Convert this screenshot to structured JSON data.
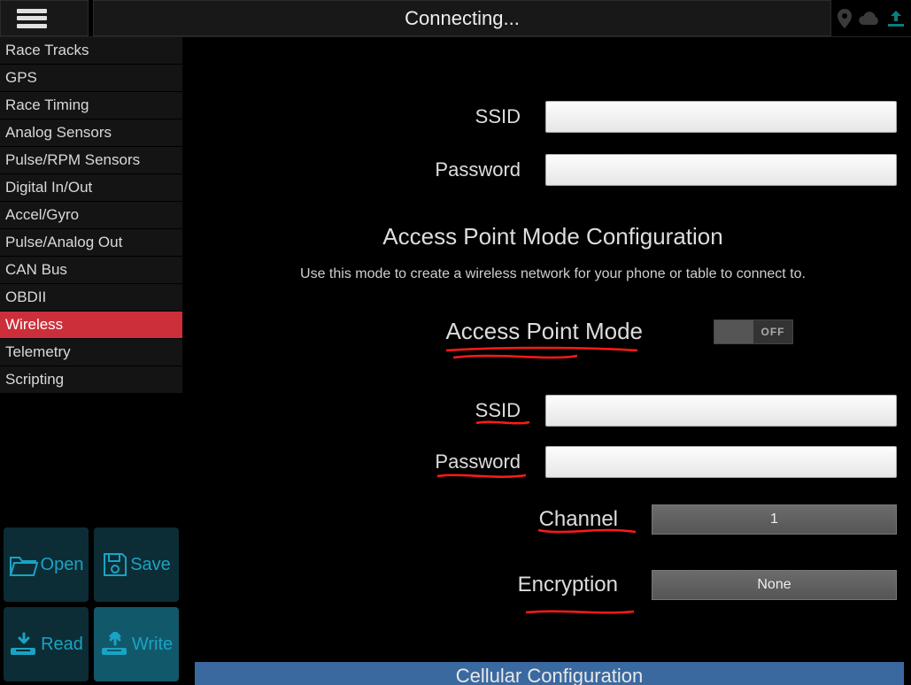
{
  "topbar": {
    "status": "Connecting..."
  },
  "sidebar": {
    "items": [
      "Race Tracks",
      "GPS",
      "Race Timing",
      "Analog Sensors",
      "Pulse/RPM Sensors",
      "Digital In/Out",
      "Accel/Gyro",
      "Pulse/Analog Out",
      "CAN Bus",
      "OBDII",
      "Wireless",
      "Telemetry",
      "Scripting"
    ],
    "active_index": 10
  },
  "buttons": {
    "open": "Open",
    "save": "Save",
    "read": "Read",
    "write": "Write"
  },
  "client_mode": {
    "ssid_label": "SSID",
    "ssid_value": "",
    "pwd_label": "Password",
    "pwd_value": ""
  },
  "ap": {
    "section_title": "Access Point Mode Configuration",
    "desc": "Use this mode to create a wireless network for your phone or table to connect to.",
    "mode_label": "Access Point Mode",
    "toggle_state": "OFF",
    "ssid_label": "SSID",
    "ssid_value": "",
    "pwd_label": "Password",
    "pwd_value": "",
    "channel_label": "Channel",
    "channel_value": "1",
    "encryption_label": "Encryption",
    "encryption_value": "None"
  },
  "cellular": {
    "header": "Cellular Configuration"
  }
}
